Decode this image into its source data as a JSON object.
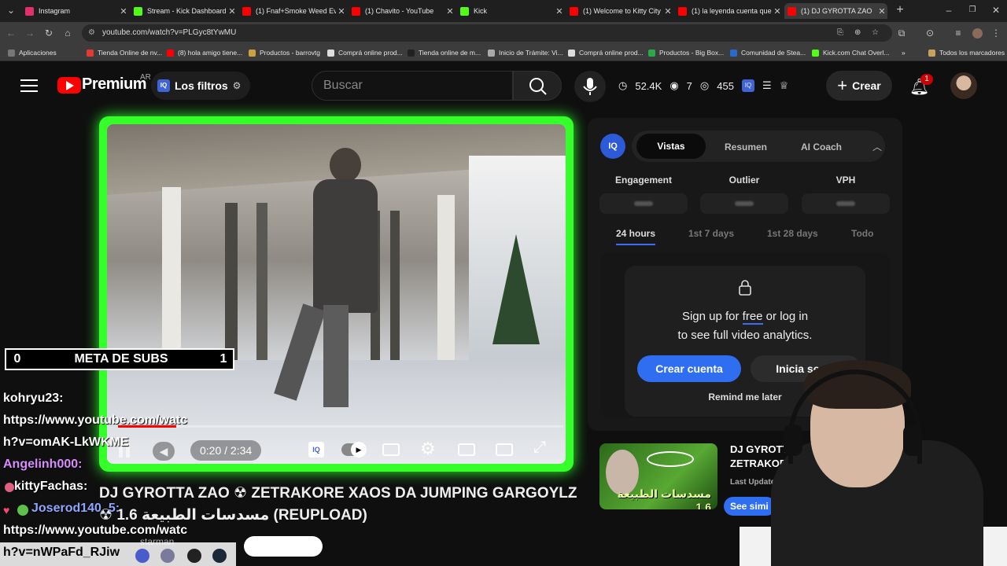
{
  "browser": {
    "tabs": [
      {
        "title": "Instagram",
        "icon": "instagram-icon",
        "color": "#e1306c"
      },
      {
        "title": "Stream - Kick Dashboard",
        "icon": "kick-icon",
        "color": "#53fc18"
      },
      {
        "title": "(1) Fnaf+Smoke Weed Ev",
        "icon": "youtube-icon",
        "color": "#ff0000"
      },
      {
        "title": "(1) Chavito - YouTube",
        "icon": "youtube-icon",
        "color": "#ff0000"
      },
      {
        "title": "Kick",
        "icon": "kick-icon",
        "color": "#53fc18"
      },
      {
        "title": "(1) Welcome to Kitty City",
        "icon": "youtube-icon",
        "color": "#ff0000"
      },
      {
        "title": "(1) la leyenda cuenta que",
        "icon": "youtube-icon",
        "color": "#ff0000"
      },
      {
        "title": "(1) DJ GYROTTA ZAO",
        "icon": "youtube-icon",
        "color": "#ff0000"
      }
    ],
    "url": "youtube.com/watch?v=PLGyc8tYwMU",
    "bookmarks": [
      "Aplicaciones",
      "Tienda Online de nv...",
      "(8) hola amigo tiene...",
      "Productos - barrovtg",
      "Comprá online prod...",
      "Tienda online de m...",
      "Inicio de Trámite: Vi...",
      "Comprá online prod...",
      "Productos - Big Box...",
      "Comunidad de Stea...",
      "Kick.com Chat Overl..."
    ],
    "bookmarks_more": "»",
    "all_bookmarks": "Todos los marcadores"
  },
  "youtube": {
    "logo": "Premium",
    "region": "AR",
    "filters_label": "Los filtros",
    "search_placeholder": "Buscar",
    "stats": {
      "views": "52.4K",
      "eyes": "7",
      "watching": "455"
    },
    "create_label": "Crear",
    "notifications": "1"
  },
  "player": {
    "time": "0:20 / 2:34",
    "progress_fraction": 0.13
  },
  "video": {
    "title_prefix": "DJ GYROTTA ZAO",
    "title_middle": "ZETRAKORE XAOS DA JUMPING GARGOYLZ",
    "title_arabic": "مسدسات الطبيعة 1.6",
    "title_suffix": "(REUPLOAD)",
    "title_sym1": "☢",
    "title_sym2": "☢",
    "channel_partial": "starman"
  },
  "panel": {
    "tabs": [
      "Vistas",
      "Resumen",
      "AI Coach"
    ],
    "metrics": [
      "Engagement",
      "Outlier",
      "VPH"
    ],
    "ranges": [
      "24 hours",
      "1st 7 days",
      "1st 28 days",
      "Todo"
    ],
    "signup_line1_pre": "Sign up for ",
    "signup_free": "free",
    "signup_line1_post": " or log in",
    "signup_line2": "to see full video analytics.",
    "create_account": "Crear cuenta",
    "login": "Inicia sesió",
    "remind": "Remind me later",
    "rec_title_1": "DJ GYROTTA",
    "rec_title_2": "ZETRAKORE X",
    "rec_updated": "Last Updated O",
    "see_similar": "See simi",
    "thumb_text": "مسدسات الطبيعة 1.6"
  },
  "overlay": {
    "meta_left": "0",
    "meta_label": "META DE SUBS",
    "meta_right": "1",
    "chat": [
      {
        "user": "kohryu23:",
        "color": "#ffffff"
      },
      {
        "text": "https://www.youtube.com/watc",
        "color": "#ffffff"
      },
      {
        "text": "h?v=omAK-LkWKME",
        "color": "#ffffff"
      },
      {
        "user": "Angelinh000:",
        "color": "#d88cff"
      },
      {
        "user": "kittyFachas:",
        "color": "#ffffff"
      },
      {
        "user": "Joserod140_5:",
        "color": "#8ea6ff"
      },
      {
        "text": "https://www.youtube.com/watc",
        "color": "#ffffff"
      },
      {
        "text": "h?v=nWPaFd_RJiw",
        "color": "#ffffff"
      }
    ]
  }
}
